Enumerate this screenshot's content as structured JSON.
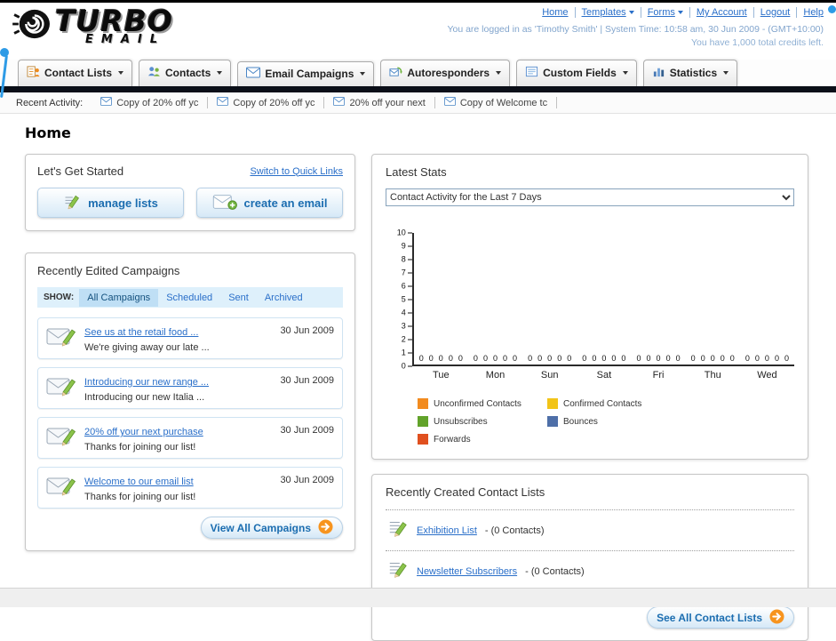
{
  "page": {
    "title": "Home"
  },
  "header": {
    "logo_primary": "TURBO",
    "logo_secondary": "EMAIL",
    "links": [
      "Home",
      "Templates",
      "Forms",
      "My Account",
      "Logout",
      "Help"
    ],
    "login_info": "You are logged in as 'Timothy Smith' | System Time: 10:58 am, 30 Jun 2009 - (GMT+10:00)",
    "credits_info": "You have 1,000 total credits left."
  },
  "nav": {
    "tabs": [
      {
        "label": "Contact Lists",
        "icon": "contact-lists-icon"
      },
      {
        "label": "Contacts",
        "icon": "contacts-icon"
      },
      {
        "label": "Email Campaigns",
        "icon": "email-campaigns-icon"
      },
      {
        "label": "Autoresponders",
        "icon": "autoresponders-icon"
      },
      {
        "label": "Custom Fields",
        "icon": "custom-fields-icon"
      },
      {
        "label": "Statistics",
        "icon": "statistics-icon"
      }
    ]
  },
  "recent_activity": {
    "label": "Recent Activity:",
    "items": [
      "Copy of 20% off yc",
      "Copy of 20% off yc",
      "20% off your next",
      "Copy of Welcome tc"
    ]
  },
  "get_started": {
    "title": "Let's Get Started",
    "switch_link": "Switch to Quick Links",
    "manage_lists_label": "manage lists",
    "create_email_label": "create an email"
  },
  "campaigns": {
    "title": "Recently Edited Campaigns",
    "show_label": "SHOW:",
    "filters": [
      "All Campaigns",
      "Scheduled",
      "Sent",
      "Archived"
    ],
    "selected_filter": "All Campaigns",
    "items": [
      {
        "title": "See us at the retail food ...",
        "subtitle": "We're giving away our late ...",
        "date": "30 Jun 2009"
      },
      {
        "title": "Introducing our new range ...",
        "subtitle": "Introducing our new Italia ...",
        "date": "30 Jun 2009"
      },
      {
        "title": "20% off your next purchase",
        "subtitle": "Thanks for joining our list!",
        "date": "30 Jun 2009"
      },
      {
        "title": "Welcome to our email list",
        "subtitle": "Thanks for joining our list!",
        "date": "30 Jun 2009"
      }
    ],
    "view_all_label": "View All Campaigns"
  },
  "stats": {
    "title": "Latest Stats",
    "selected_option": "Contact Activity for the Last 7 Days"
  },
  "chart_data": {
    "type": "bar",
    "title": "Contact Activity for the Last 7 Days",
    "categories": [
      "Tue",
      "Mon",
      "Sun",
      "Sat",
      "Fri",
      "Thu",
      "Wed"
    ],
    "series": [
      {
        "name": "Unconfirmed Contacts",
        "color": "#F28B1F",
        "values": [
          0,
          0,
          0,
          0,
          0,
          0,
          0
        ]
      },
      {
        "name": "Confirmed Contacts",
        "color": "#F2C418",
        "values": [
          0,
          0,
          0,
          0,
          0,
          0,
          0
        ]
      },
      {
        "name": "Unsubscribes",
        "color": "#62A32A",
        "values": [
          0,
          0,
          0,
          0,
          0,
          0,
          0
        ]
      },
      {
        "name": "Bounces",
        "color": "#4E6FA8",
        "values": [
          0,
          0,
          0,
          0,
          0,
          0,
          0
        ]
      },
      {
        "name": "Forwards",
        "color": "#E0501F",
        "values": [
          0,
          0,
          0,
          0,
          0,
          0,
          0
        ]
      }
    ],
    "ylim": [
      0,
      10
    ],
    "yticks": [
      10,
      9,
      8,
      7,
      6,
      5,
      4,
      3,
      2,
      1,
      0
    ],
    "grid": false,
    "legend_position": "bottom"
  },
  "contact_lists": {
    "title": "Recently Created Contact Lists",
    "items": [
      {
        "name": "Exhibition List",
        "suffix": "- (0 Contacts)"
      },
      {
        "name": "Newsletter Subscribers",
        "suffix": "- (0 Contacts)"
      }
    ],
    "see_all_label": "See All Contact Lists"
  },
  "colors": {
    "link_blue": "#2A6FC9",
    "accent_orange": "#F7941E",
    "navbar_dark": "#0B0F18",
    "filter_bar_blue": "#DEF0FB"
  }
}
